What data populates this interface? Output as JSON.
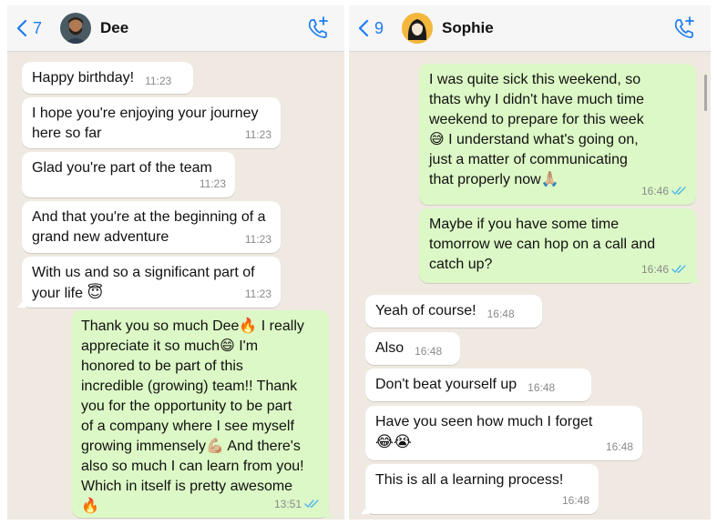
{
  "left_chat": {
    "back_count": "7",
    "contact_name": "Dee",
    "messages": [
      {
        "text": "Happy birthday!",
        "time": "11:23"
      },
      {
        "text": "I hope you're enjoying your journey here so far",
        "time": "11:23"
      },
      {
        "text": "Glad you're part of the team",
        "time": "11:23"
      },
      {
        "text": "And that you're at the beginning of a grand new adventure",
        "time": "11:23"
      },
      {
        "text": "With us and so a significant part of your life",
        "emoji": "😇",
        "time": "11:23"
      },
      {
        "lines": [
          "Thank you so much Dee🔥 I really",
          "appreciate it so much😄 I'm",
          "honored to be part of this",
          "incredible (growing) team!! Thank",
          "you for the opportunity to be part",
          "of a company where I see myself",
          "growing immensely💪🏼 And there's",
          "also so much I can learn from you!",
          "Which in itself is pretty awesome",
          "🔥"
        ],
        "time": "13:51"
      }
    ]
  },
  "right_chat": {
    "back_count": "9",
    "contact_name": "Sophie",
    "messages": [
      {
        "lines": [
          "I was quite sick this weekend, so",
          "thats why I didn't have much time",
          "weekend to prepare for this week",
          "😅 I understand what's going on,",
          "just a matter of communicating",
          "that properly now🙏🏼"
        ],
        "time": "16:46"
      },
      {
        "lines": [
          "Maybe if you have some time",
          "tomorrow we can hop on a call and",
          "catch up?"
        ],
        "time": "16:46"
      },
      {
        "text": "Yeah of course!",
        "time": "16:48"
      },
      {
        "text": "Also",
        "time": "16:48"
      },
      {
        "text": "Don't beat yourself up",
        "time": "16:48"
      },
      {
        "text": "Have you seen how much I forget",
        "emoji": "😂😭",
        "time": "16:48"
      },
      {
        "text": "This is all a learning process!",
        "time": "16:48"
      }
    ]
  },
  "icons": {
    "back": "chevron-left-icon",
    "call": "phone-plus-icon",
    "read": "double-check-icon"
  },
  "colors": {
    "accent": "#1c7cf2",
    "outgoing_bubble": "#dcf8c6",
    "incoming_bubble": "#ffffff",
    "chat_background": "#efe9e1",
    "read_ticks": "#4fb6ec"
  }
}
